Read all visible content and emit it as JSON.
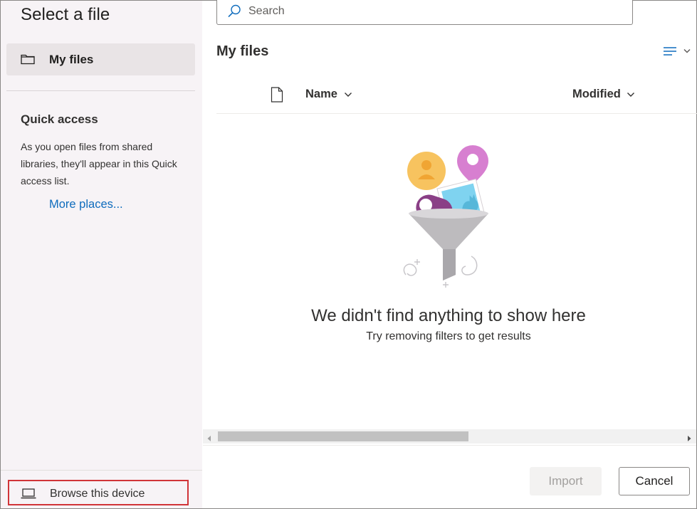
{
  "dialog": {
    "title": "Select a file"
  },
  "sidebar": {
    "nav_items": [
      {
        "label": "My files",
        "icon": "folder-icon"
      }
    ],
    "quick_access": {
      "title": "Quick access",
      "description": "As you open files from shared libraries, they'll appear in this Quick access list.",
      "more_places": "More places..."
    },
    "browse_device": {
      "label": "Browse this device",
      "icon": "laptop-icon"
    }
  },
  "search": {
    "placeholder": "Search",
    "value": ""
  },
  "main": {
    "title": "My files",
    "columns": [
      {
        "label": "Name"
      },
      {
        "label": "Modified"
      }
    ],
    "empty_state": {
      "title": "We didn't find anything to show here",
      "subtitle": "Try removing filters to get results"
    }
  },
  "footer": {
    "import_label": "Import",
    "cancel_label": "Cancel"
  },
  "colors": {
    "sidebar_bg": "#f7f3f6",
    "selected_bg": "#e9e4e6",
    "link": "#0f6cbd",
    "highlight_border": "#d13438"
  }
}
